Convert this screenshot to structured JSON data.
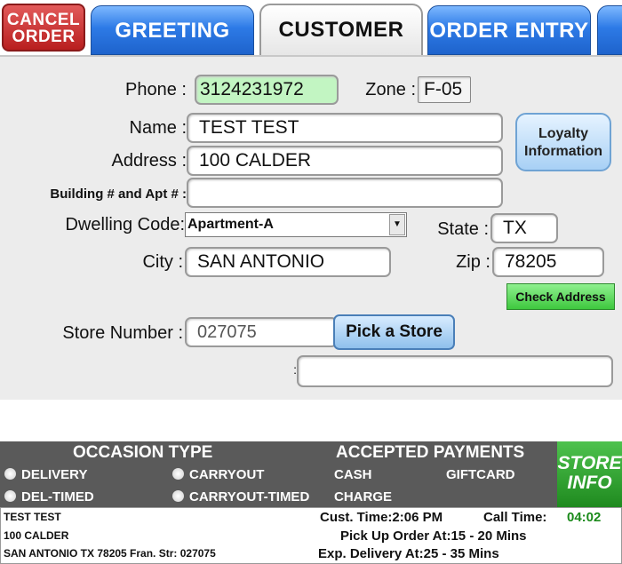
{
  "tabs": {
    "cancel": "CANCEL\nORDER",
    "cancel_line1": "CANCEL",
    "cancel_line2": "ORDER",
    "greeting": "GREETING",
    "customer": "CUSTOMER",
    "order_entry": "ORDER ENTRY"
  },
  "form": {
    "phone_label": "Phone :",
    "phone_value": "3124231972",
    "zone_label": "Zone :",
    "zone_value": "F-05",
    "name_label": "Name :",
    "name_value": "TEST TEST",
    "address_label": "Address :",
    "address_value": "100 CALDER",
    "building_label": "Building # and Apt # :",
    "building_value": "",
    "dwelling_label": "Dwelling Code:",
    "dwelling_value": "Apartment-A",
    "state_label": "State :",
    "state_value": "TX",
    "city_label": "City :",
    "city_value": "SAN ANTONIO",
    "zip_label": "Zip :",
    "zip_value": "78205",
    "store_label": "Store Number :",
    "store_value": "027075",
    "extra_label": ":",
    "extra_value": "",
    "loyalty_line1": "Loyalty",
    "loyalty_line2": "Information",
    "check_address": "Check Address",
    "pick_store": "Pick a Store"
  },
  "info": {
    "occasion_title": "OCCASION TYPE",
    "occasions": [
      "DELIVERY",
      "CARRYOUT",
      "DEL-TIMED",
      "CARRYOUT-TIMED"
    ],
    "payments_title": "ACCEPTED PAYMENTS",
    "payments": [
      "CASH",
      "GIFTCARD",
      "CHARGE"
    ],
    "store_info_line1": "STORE",
    "store_info_line2": "INFO",
    "customer_name": "TEST TEST",
    "customer_address": "100 CALDER",
    "customer_city_line": "SAN ANTONIO TX   78205 Fran. Str: 027075",
    "cust_time": "Cust. Time:2:06 PM",
    "call_time_label": "Call Time:",
    "call_time_value": "04:02",
    "pickup": "Pick Up Order At:15 - 20 Mins",
    "delivery": "Exp. Delivery At:25 - 35 Mins"
  },
  "colors": {
    "tab_blue": "#2d7ae6",
    "cancel_red": "#b81e1e",
    "phone_green": "#c2f5c2",
    "store_info_green": "#1f8a1f",
    "header_gray": "#5a5a5a"
  }
}
